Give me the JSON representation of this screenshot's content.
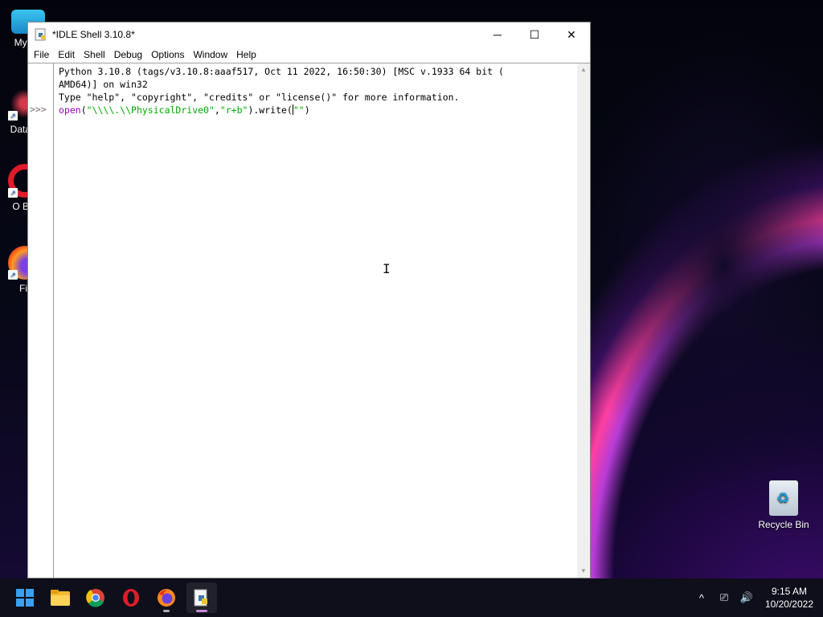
{
  "desktop": {
    "icons": [
      {
        "label": "My Co"
      },
      {
        "label": "DataW"
      },
      {
        "label": "O Bro"
      },
      {
        "label": "Fir"
      }
    ],
    "recycle_bin_label": "Recycle Bin"
  },
  "window": {
    "title": "*IDLE Shell 3.10.8*",
    "controls": {
      "minimize": "─",
      "maximize": "☐",
      "close": "✕"
    },
    "menu": [
      "File",
      "Edit",
      "Shell",
      "Debug",
      "Options",
      "Window",
      "Help"
    ]
  },
  "shell": {
    "banner_line1": "Python 3.10.8 (tags/v3.10.8:aaaf517, Oct 11 2022, 16:50:30) [MSC v.1933 64 bit (",
    "banner_line2": "AMD64)] on win32",
    "banner_line3": "Type \"help\", \"copyright\", \"credits\" or \"license()\" for more information.",
    "prompt": ">>>",
    "input": {
      "builtin": "open",
      "p1": "(",
      "s1": "\"\\\\\\\\.\\\\PhysicalDrive0\"",
      "comma": ",",
      "s2": "\"r+b\"",
      "p2": ").write(",
      "s3a": "\"",
      "s3b": "\"",
      "p3": ")"
    },
    "colors": {
      "builtin": "#9b00c8",
      "string": "#00aa00"
    }
  },
  "taskbar": {
    "apps": [
      "start-icon",
      "file-explorer-icon",
      "chrome-icon",
      "opera-icon",
      "firefox-icon",
      "idle-python-icon"
    ],
    "tray": {
      "chevron": "^",
      "network": "⎚",
      "volume": "🔊"
    },
    "time": "9:15 AM",
    "date": "10/20/2022"
  }
}
